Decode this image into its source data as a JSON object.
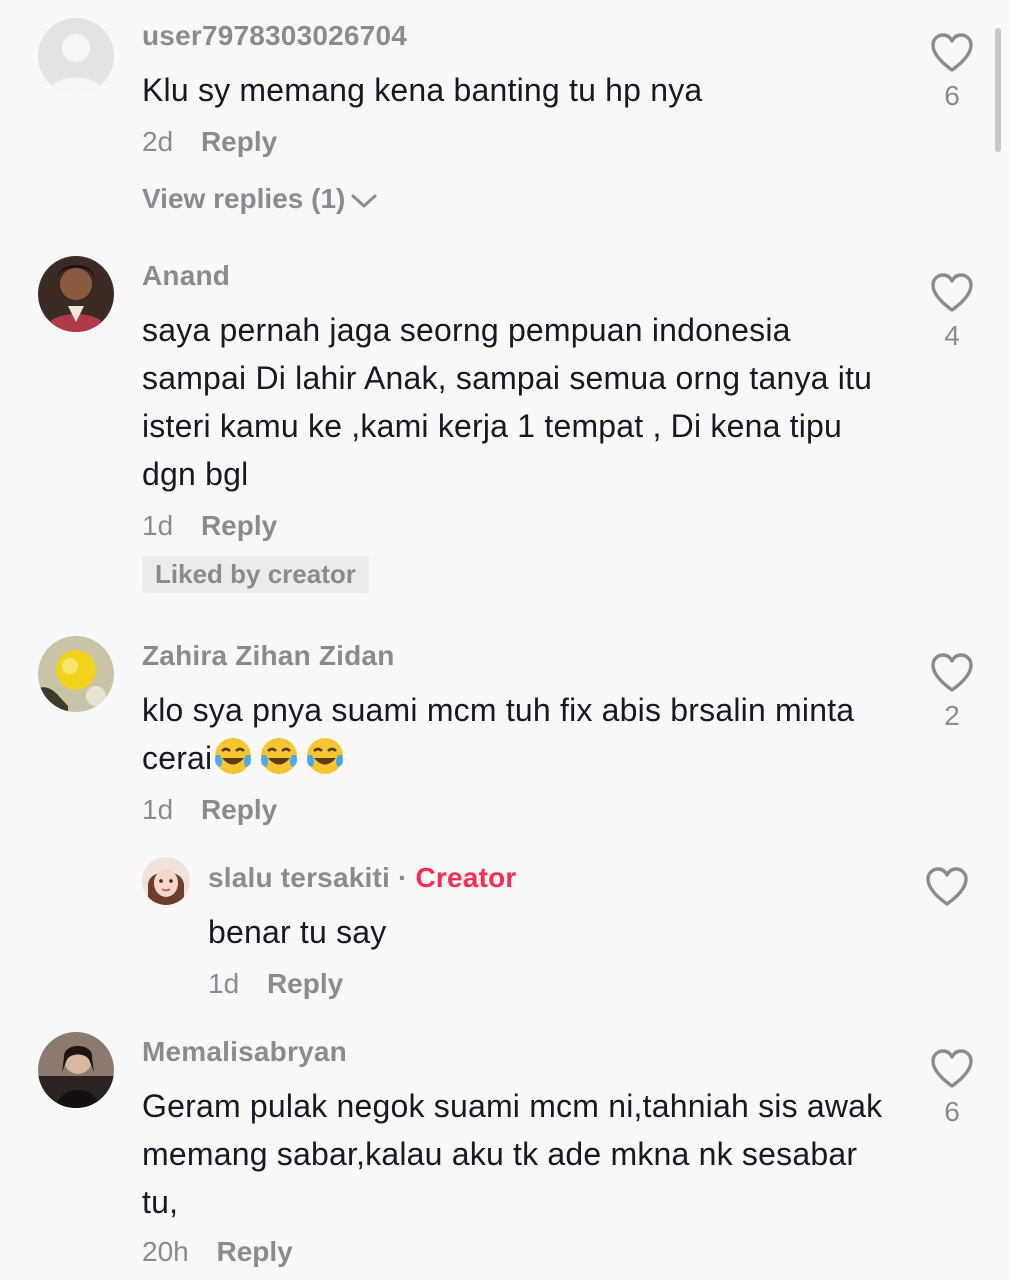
{
  "comments": [
    {
      "username": "user7978303026704",
      "text": "Klu sy memang kena banting tu hp nya",
      "time": "2d",
      "reply_label": "Reply",
      "likes": "6",
      "view_replies": "View replies (1)"
    },
    {
      "username": "Anand",
      "text": "saya pernah jaga seorng pempuan indonesia sampai Di lahir Anak, sampai semua orng tanya itu isteri kamu ke ,kami kerja 1 tempat , Di kena tipu dgn bgl",
      "time": "1d",
      "reply_label": "Reply",
      "likes": "4",
      "badge": "Liked by creator"
    },
    {
      "username": "Zahira Zihan Zidan",
      "text": "klo sya pnya suami mcm tuh fix abis brsalin minta cerai",
      "time": "1d",
      "reply_label": "Reply",
      "likes": "2",
      "emoji_name": "face-with-tears-of-joy",
      "emoji_count": 3
    },
    {
      "username": "slalu tersakiti",
      "dot": "·",
      "creator_label": "Creator",
      "text": "benar tu say",
      "time": "1d",
      "reply_label": "Reply"
    },
    {
      "username": "Memalisabryan",
      "text": "Geram pulak negok suami mcm ni,tahniah sis awak memang sabar,kalau aku tk ade mkna nk sesabar tu,",
      "time": "20h",
      "reply_label": "Reply",
      "likes": "6"
    }
  ],
  "icons": {
    "like": "heart-outline-icon",
    "expand": "chevron-down-icon",
    "default_avatar": "default-user-avatar-icon"
  },
  "colors": {
    "background": "#f8f8f8",
    "text": "#161823",
    "secondary": "#8a8b91",
    "creator": "#fe2c55"
  }
}
